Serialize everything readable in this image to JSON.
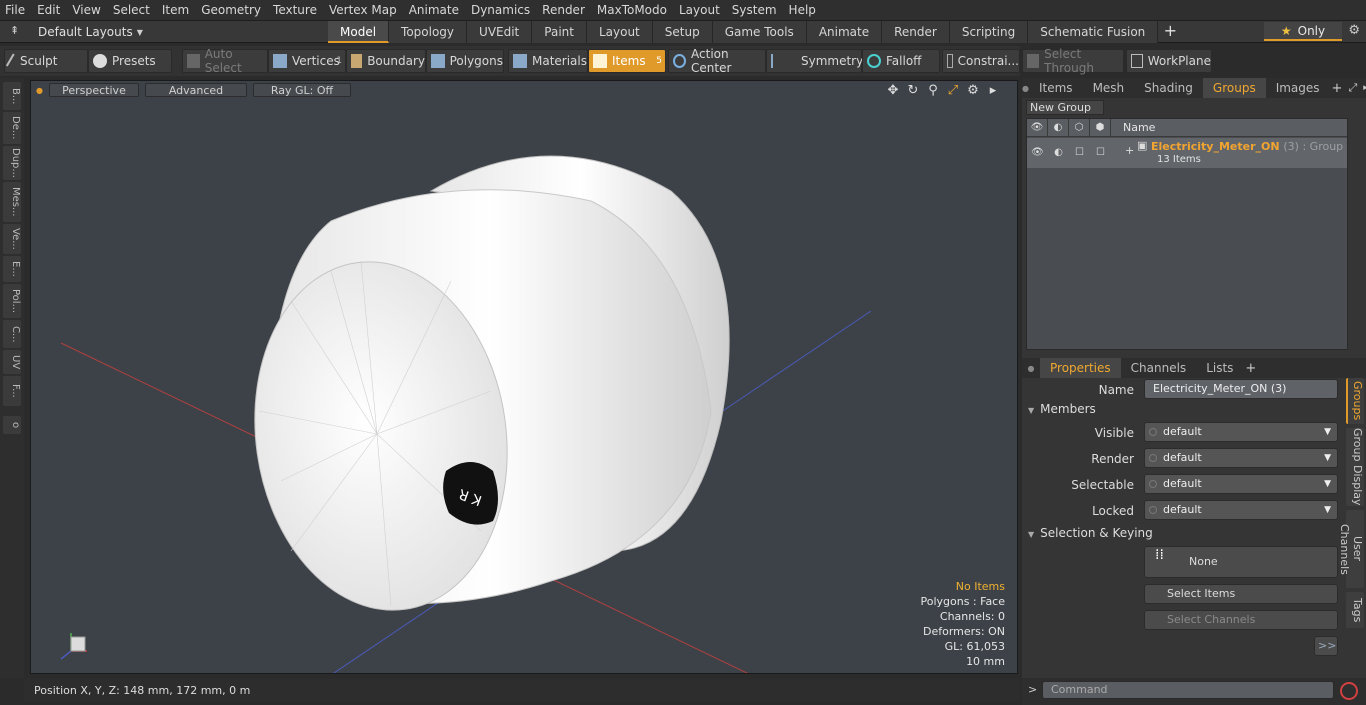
{
  "menu": [
    "File",
    "Edit",
    "View",
    "Select",
    "Item",
    "Geometry",
    "Texture",
    "Vertex Map",
    "Animate",
    "Dynamics",
    "Render",
    "MaxToModo",
    "Layout",
    "System",
    "Help"
  ],
  "layout_selector": "Default Layouts",
  "mode_tabs": [
    "Model",
    "Topology",
    "UVEdit",
    "Paint",
    "Layout",
    "Setup",
    "Game Tools",
    "Animate",
    "Render",
    "Scripting",
    "Schematic Fusion"
  ],
  "only_label": "Only",
  "toolbar": {
    "sculpt": "Sculpt",
    "presets": "Presets",
    "auto_select": "Auto Select",
    "vertices": "Vertices",
    "vertices_count": "1",
    "boundary": "Boundary",
    "polygons": "Polygons",
    "materials": "Materials",
    "items": "Items",
    "items_count": "5",
    "action_center": "Action Center",
    "symmetry": "Symmetry",
    "falloff": "Falloff",
    "constraints": "Constrai...",
    "select_through": "Select Through",
    "workplane": "WorkPlane"
  },
  "left_tabs": [
    "B...",
    "De...",
    "Dup...",
    "Mes...",
    "Ve...",
    "E...",
    "Pol...",
    "C...",
    "UV",
    "F..."
  ],
  "viewport": {
    "view": "Perspective",
    "shading": "Advanced",
    "raygl": "Ray GL: Off",
    "stats": {
      "items": "No Items",
      "polygons": "Polygons : Face",
      "channels": "Channels: 0",
      "deformers": "Deformers: ON",
      "gl": "GL: 61,053",
      "scale": "10 mm"
    }
  },
  "status": {
    "position": "Position X, Y, Z:  148 mm, 172 mm, 0 m"
  },
  "top_panel": {
    "tabs": [
      "Items",
      "Mesh ...",
      "Shading",
      "Groups",
      "Images"
    ],
    "active_tab": "Groups",
    "new_group": "New Group",
    "column_name": "Name",
    "group": {
      "name": "Electricity_Meter_ON",
      "suffix": "(3) : Group",
      "items": "13 Items"
    }
  },
  "properties": {
    "tabs": [
      "Properties",
      "Channels",
      "Lists"
    ],
    "name_label": "Name",
    "name_value": "Electricity_Meter_ON (3)",
    "members_label": "Members",
    "visible_label": "Visible",
    "visible_value": "default",
    "render_label": "Render",
    "render_value": "default",
    "selectable_label": "Selectable",
    "selectable_value": "default",
    "locked_label": "Locked",
    "locked_value": "default",
    "selection_label": "Selection & Keying",
    "none_label": "None",
    "select_items": "Select Items",
    "select_channels": "Select Channels",
    "more": ">>"
  },
  "side_tabs": [
    "Groups",
    "Group Display",
    "User Channels",
    "Tags"
  ],
  "command": {
    "placeholder": "Command"
  }
}
